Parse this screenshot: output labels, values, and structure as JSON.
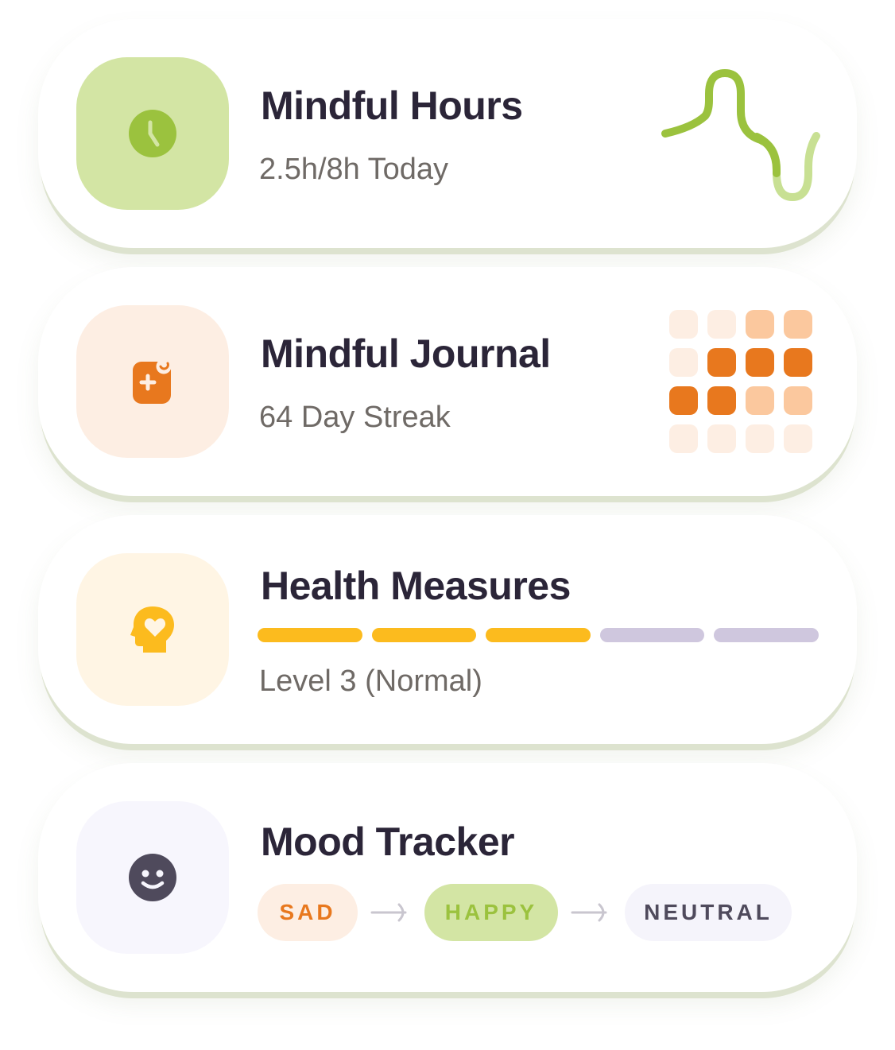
{
  "cards": {
    "hours": {
      "title": "Mindful Hours",
      "subtitle": "2.5h/8h Today",
      "icon": "clock-icon",
      "accent": "#9bc23e",
      "icon_bg": "#d3e5a4"
    },
    "journal": {
      "title": "Mindful Journal",
      "subtitle": "64 Day Streak",
      "icon": "journal-icon",
      "accent": "#e8781e",
      "icon_bg": "#fdeee3",
      "streak_grid": [
        [
          0,
          0,
          1,
          1
        ],
        [
          0,
          2,
          2,
          2
        ],
        [
          2,
          2,
          1,
          1
        ],
        [
          0,
          0,
          0,
          0
        ]
      ],
      "grid_colors": [
        "#fdeee3",
        "#fbc89e",
        "#e8781e"
      ]
    },
    "health": {
      "title": "Health Measures",
      "subtitle": "Level 3 (Normal)",
      "icon": "head-heart-icon",
      "accent": "#fcbb1e",
      "icon_bg": "#fff5e4",
      "level": 3,
      "level_max": 5,
      "inactive_color": "#cfc7de"
    },
    "mood": {
      "title": "Mood Tracker",
      "icon": "smiley-icon",
      "icon_bg": "#f7f6fd",
      "moods": [
        {
          "label": "SAD",
          "color": "#e8781e",
          "bg": "#fdeee3"
        },
        {
          "label": "HAPPY",
          "color": "#9bc23e",
          "bg": "#d3e5a4"
        },
        {
          "label": "NEUTRAL",
          "color": "#4f4a5c",
          "bg": "#f5f4fb"
        }
      ]
    }
  }
}
